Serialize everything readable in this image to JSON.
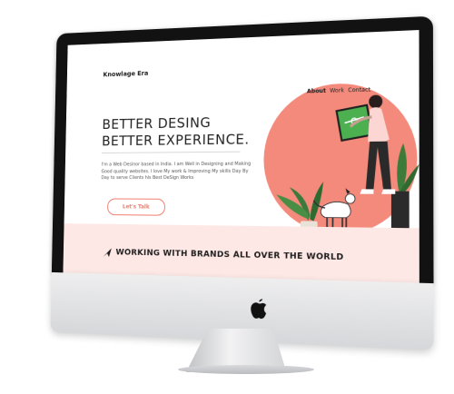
{
  "site": {
    "brand": "Knowlage Era",
    "nav": [
      "About",
      "Work",
      "Contact"
    ],
    "headline_line1": "BETTER DESING",
    "headline_line2": "BETTER EXPERIENCE.",
    "intro": "I'm a Web Desinor based in India. I am Well in Designing and Making Good quality websites. I love My work & Improving My skills Day By Day to serve Clients his Best DeSign Works",
    "cta": "Let's Talk",
    "brands_banner": "WORKING WITH BRANDS ALL OVER THE WORLD"
  },
  "colors": {
    "accent": "#f07b6c",
    "pink_bg": "#fde8e5",
    "bezel": "#121212"
  },
  "icons": [
    "apple-logo-icon",
    "send-arrow-icon"
  ]
}
